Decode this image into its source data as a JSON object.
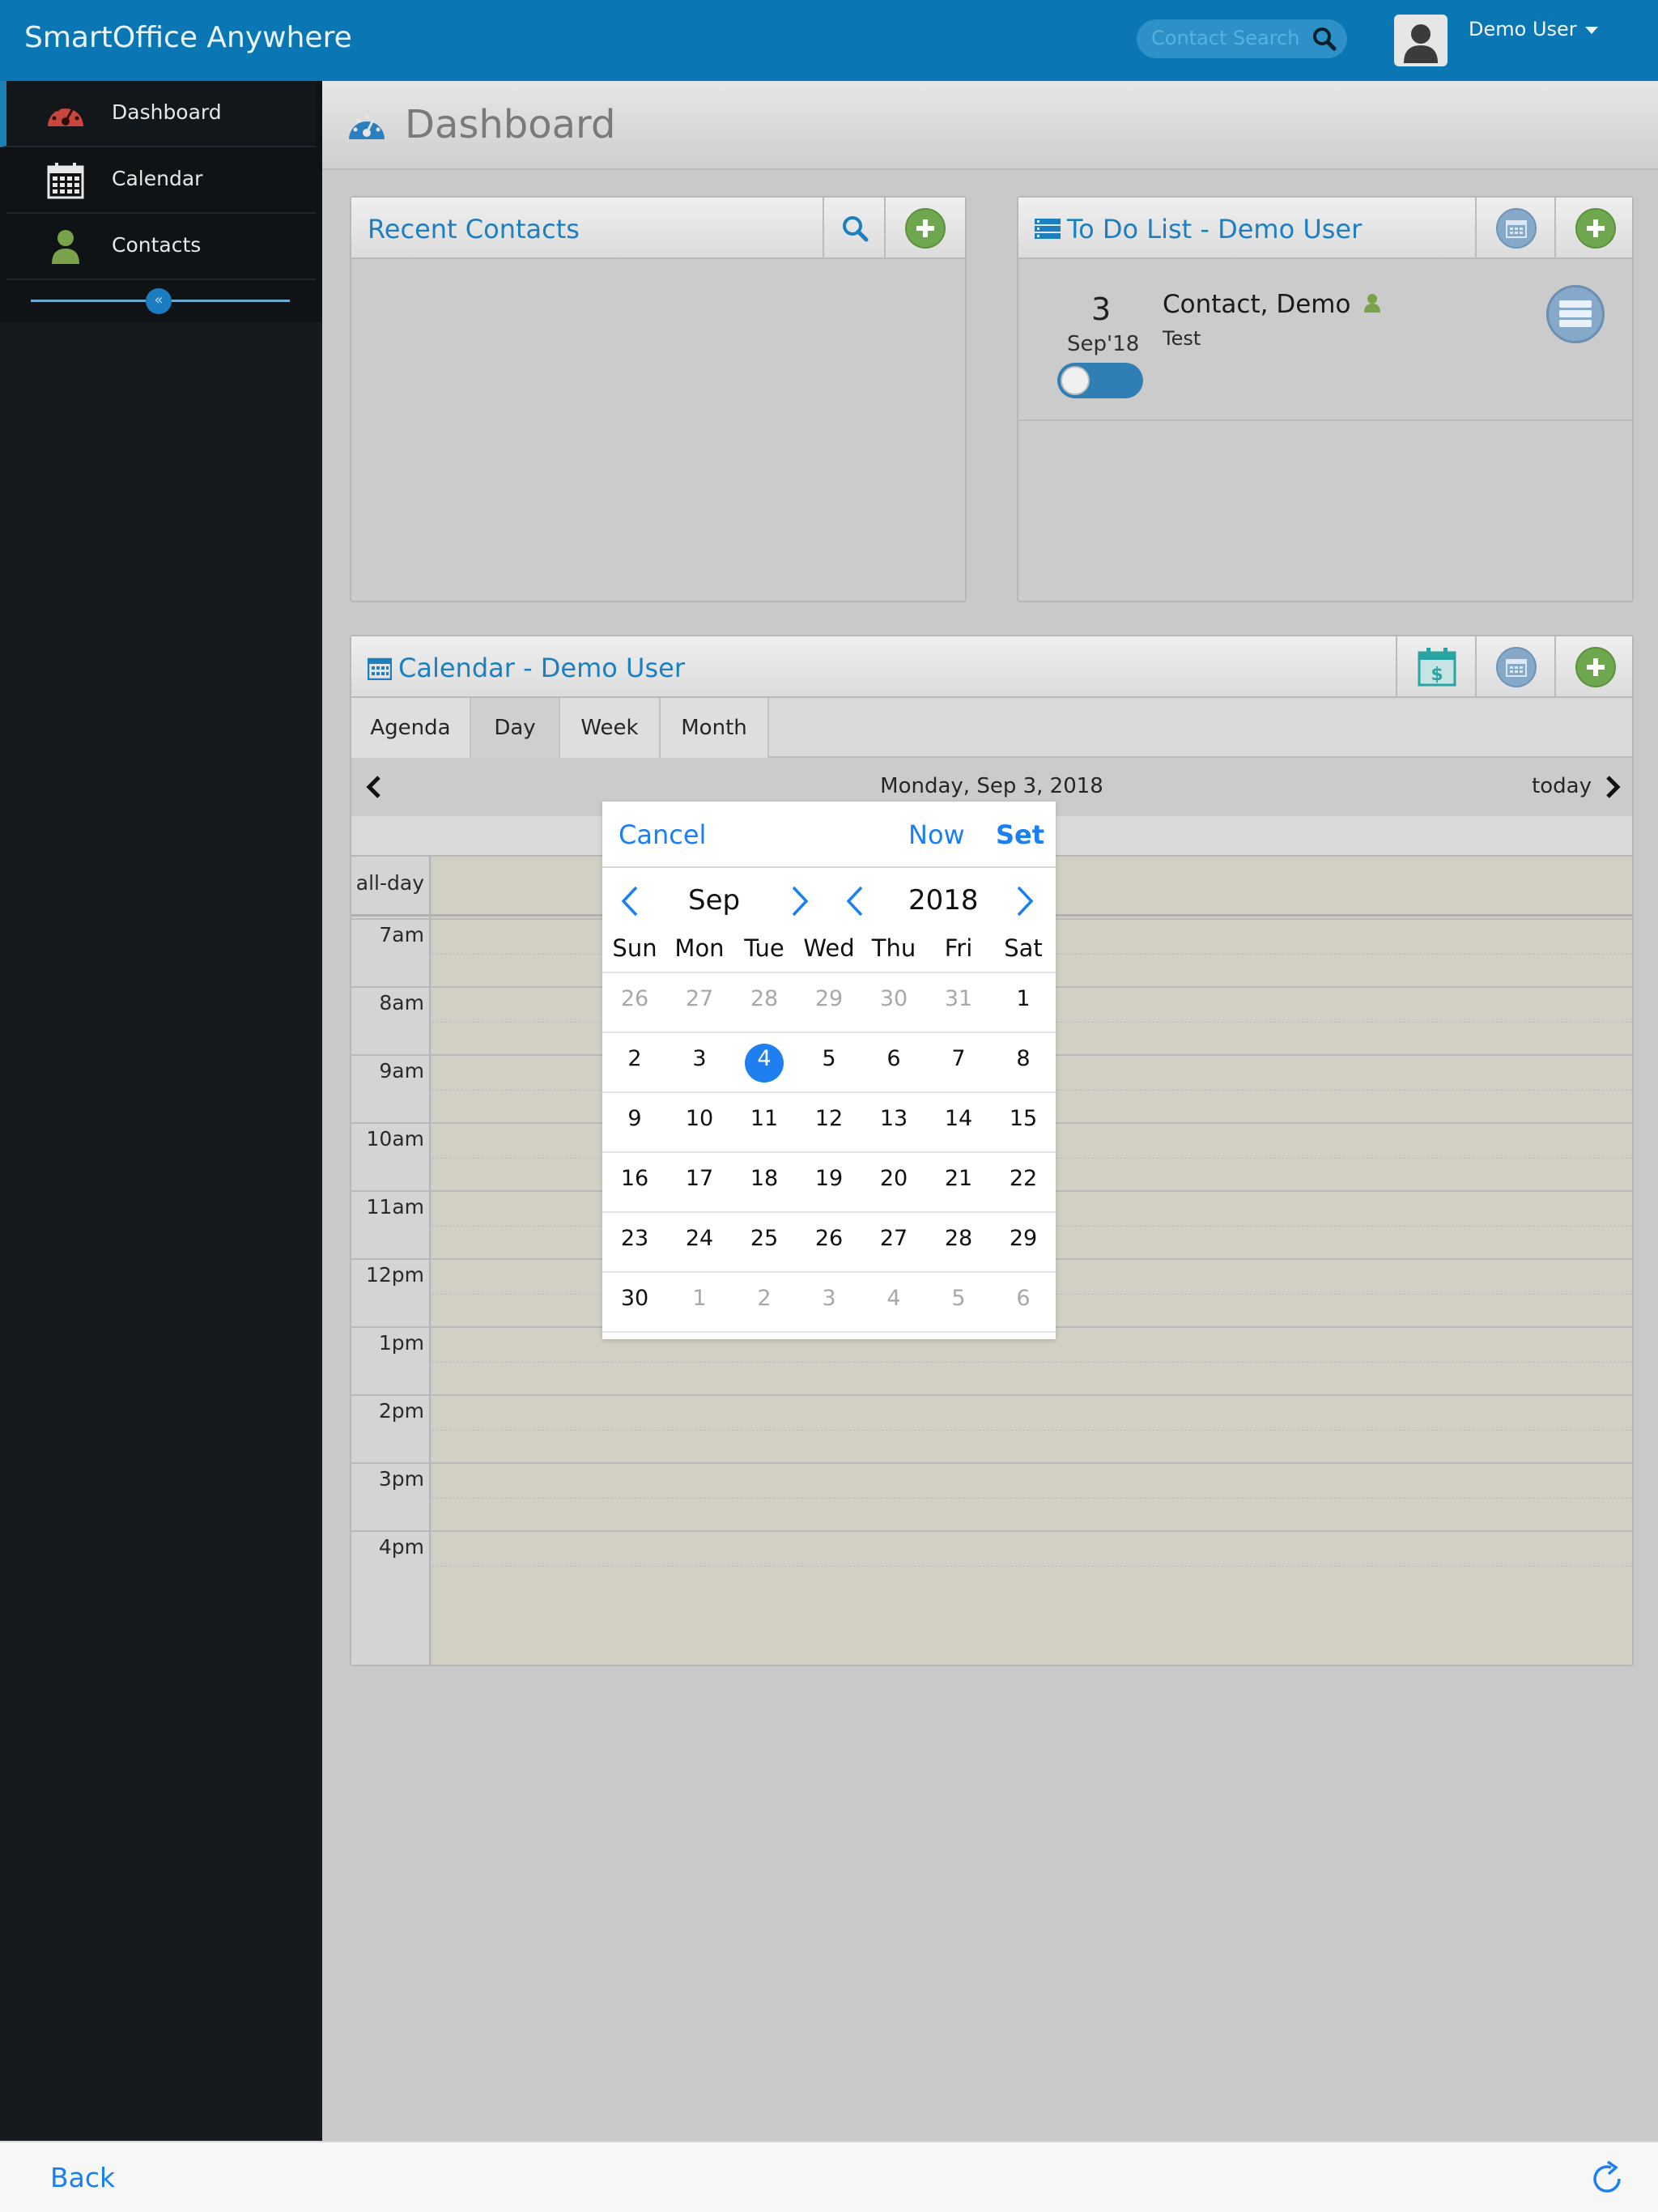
{
  "app": {
    "title": "SmartOffice Anywhere"
  },
  "header": {
    "search_placeholder": "Contact Search",
    "user_name": "Demo User"
  },
  "sidebar": {
    "items": [
      {
        "label": "Dashboard",
        "icon": "dashboard-gauge-icon",
        "active": true
      },
      {
        "label": "Calendar",
        "icon": "calendar-icon",
        "active": false
      },
      {
        "label": "Contacts",
        "icon": "contact-person-icon",
        "active": false
      }
    ],
    "collapse_icon": "collapse-chevrons-icon"
  },
  "page": {
    "title": "Dashboard"
  },
  "recent_contacts": {
    "title": "Recent Contacts"
  },
  "todo": {
    "title": "To Do List - Demo User",
    "item": {
      "day": "3",
      "month": "Sep'18",
      "name": "Contact, Demo",
      "subject": "Test"
    }
  },
  "calendar": {
    "title": "Calendar - Demo User",
    "tabs": [
      "Agenda",
      "Day",
      "Week",
      "Month"
    ],
    "active_tab": "Day",
    "date_label": "Monday, Sep 3, 2018",
    "today_label": "today",
    "allday_label": "all-day",
    "hours": [
      "7am",
      "8am",
      "9am",
      "10am",
      "11am",
      "12pm",
      "1pm",
      "2pm",
      "3pm",
      "4pm"
    ]
  },
  "picker": {
    "cancel": "Cancel",
    "now": "Now",
    "set": "Set",
    "month": "Sep",
    "year": "2018",
    "weekdays": [
      "Sun",
      "Mon",
      "Tue",
      "Wed",
      "Thu",
      "Fri",
      "Sat"
    ],
    "weeks": [
      [
        "26",
        "27",
        "28",
        "29",
        "30",
        "31",
        "1"
      ],
      [
        "2",
        "3",
        "4",
        "5",
        "6",
        "7",
        "8"
      ],
      [
        "9",
        "10",
        "11",
        "12",
        "13",
        "14",
        "15"
      ],
      [
        "16",
        "17",
        "18",
        "19",
        "20",
        "21",
        "22"
      ],
      [
        "23",
        "24",
        "25",
        "26",
        "27",
        "28",
        "29"
      ],
      [
        "30",
        "1",
        "2",
        "3",
        "4",
        "5",
        "6"
      ]
    ],
    "selected_day": "4"
  },
  "footer": {
    "back": "Back"
  },
  "colors": {
    "accent": "#1a7ff1",
    "header": "#0a76b3",
    "sidebar": "#161a1f",
    "green": "#6ea74d"
  }
}
